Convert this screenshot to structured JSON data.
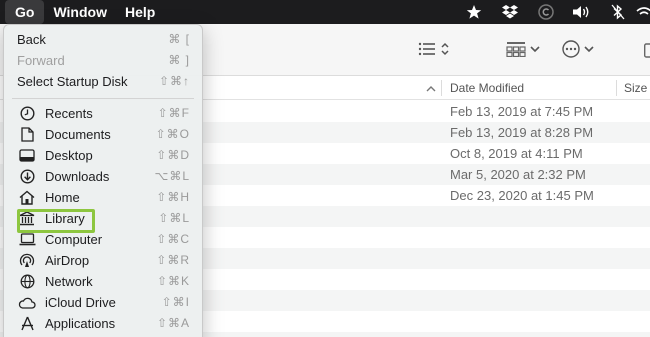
{
  "menubar": {
    "items": [
      "Go",
      "Window",
      "Help"
    ],
    "status_icons": [
      "star-icon",
      "dropbox-icon",
      "creative-cloud-icon",
      "volume-icon",
      "bluetooth-icon",
      "wifi-icon"
    ]
  },
  "toolbar": {
    "icons": [
      "list-view-icon",
      "group-icon",
      "more-actions-icon",
      "share-icon"
    ]
  },
  "columns": {
    "date_modified": "Date Modified",
    "size": "Size"
  },
  "rows": [
    {
      "date": "Feb 13, 2019 at 7:45 PM"
    },
    {
      "date": "Feb 13, 2019 at 8:28 PM"
    },
    {
      "date": "Oct 8, 2019 at 4:11 PM"
    },
    {
      "date": "Mar 5, 2020 at 2:32 PM"
    },
    {
      "date": "Dec 23, 2020 at 1:45 PM"
    },
    {
      "date": ""
    },
    {
      "date": ""
    },
    {
      "date": ""
    },
    {
      "date": ""
    },
    {
      "date": ""
    },
    {
      "date": ""
    },
    {
      "date": ""
    }
  ],
  "go_menu": {
    "back": {
      "label": "Back",
      "shortcut": "⌘ ["
    },
    "forward": {
      "label": "Forward",
      "shortcut": "⌘ ]"
    },
    "startup": {
      "label": "Select Startup Disk",
      "shortcut": "⇧⌘↑"
    },
    "recents": {
      "label": "Recents",
      "shortcut": "⇧⌘F"
    },
    "documents": {
      "label": "Documents",
      "shortcut": "⇧⌘O"
    },
    "desktop": {
      "label": "Desktop",
      "shortcut": "⇧⌘D"
    },
    "downloads": {
      "label": "Downloads",
      "shortcut": "⌥⌘L"
    },
    "home": {
      "label": "Home",
      "shortcut": "⇧⌘H"
    },
    "library": {
      "label": "Library",
      "shortcut": "⇧⌘L"
    },
    "computer": {
      "label": "Computer",
      "shortcut": "⇧⌘C"
    },
    "airdrop": {
      "label": "AirDrop",
      "shortcut": "⇧⌘R"
    },
    "network": {
      "label": "Network",
      "shortcut": "⇧⌘K"
    },
    "icloud": {
      "label": "iCloud Drive",
      "shortcut": "⇧⌘I"
    },
    "applications": {
      "label": "Applications",
      "shortcut": "⇧⌘A"
    }
  },
  "colors": {
    "highlight": "#8dc63f",
    "menubar": "#1c1c1e"
  }
}
